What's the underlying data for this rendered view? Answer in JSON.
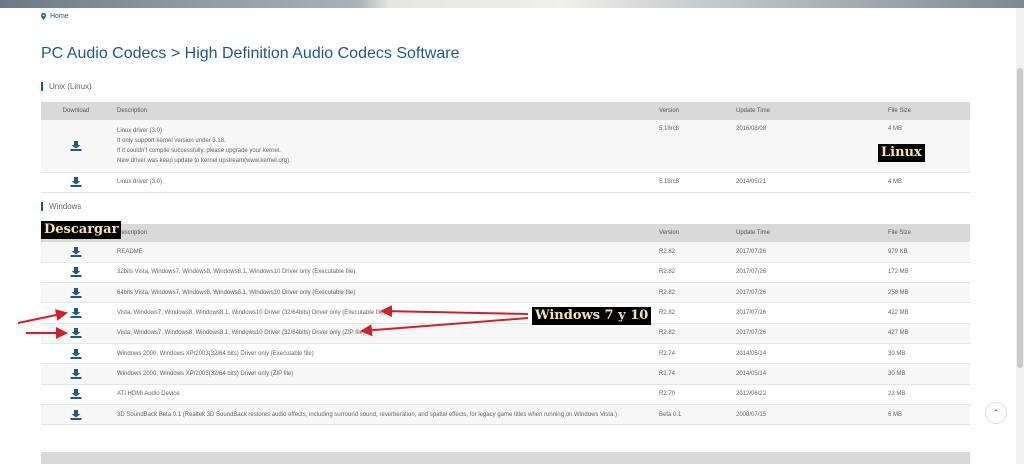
{
  "breadcrumb": {
    "home": "Home"
  },
  "page_title": "PC Audio Codecs > High Definition Audio Codecs Software",
  "columns": {
    "download": "Download",
    "description": "Description",
    "version": "Version",
    "update_time": "Update Time",
    "file_size": "File Size"
  },
  "unix": {
    "section_label": "Unix (Linux)",
    "rows": [
      {
        "lines": [
          "Linux driver (3.0)",
          "It only support kernel version under 3.18.",
          "If it couldn't compile successfully, please upgrade your kernel.",
          "New driver was keep update to kernel upstream(www.kernel.org)."
        ],
        "version": "5.18rc8",
        "date": "2016/08/08",
        "size": "4 MB"
      },
      {
        "lines": [
          "Linux driver (3.0)"
        ],
        "version": "5.18rc8",
        "date": "2014/05/21",
        "size": "4 MB"
      }
    ]
  },
  "windows": {
    "section_label": "Windows",
    "rows": [
      {
        "description": "README",
        "version": "R2.82",
        "date": "2017/07/26",
        "size": "979 KB"
      },
      {
        "description": "32bits Vista, Windows7, Windows8, Windows8.1, Windows10 Driver only (Executable file)",
        "version": "R2.82",
        "date": "2017/07/26",
        "size": "172 MB"
      },
      {
        "description": "64bits Vista, Windows7, Windows8, Windows8.1, Windows10 Driver only (Executable file)",
        "version": "R2.82",
        "date": "2017/07/26",
        "size": "258 MB"
      },
      {
        "description": "Vista, Windows7, Windows8, Windows8.1, Windows10 Driver (32/64bits) Driver only (Executable file)",
        "version": "R2.82",
        "date": "2017/07/26",
        "size": "422 MB"
      },
      {
        "description": "Vista, Windows7, Windows8, Windows8.1, Windows10 Driver (32/64bits) Driver only (ZIP file)",
        "version": "R2.82",
        "date": "2017/07/26",
        "size": "427 MB"
      },
      {
        "description": "Windows 2000, Windows XP/2003(32/64 bits) Driver only (Executable file)",
        "version": "R2.74",
        "date": "2014/05/14",
        "size": "30 MB"
      },
      {
        "description": "Windows 2000, Windows XP/2003(32/64 bits) Driver only (ZIP file)",
        "version": "R2.74",
        "date": "2014/05/14",
        "size": "30 MB"
      },
      {
        "description": "ATI HDMI Audio Device",
        "version": "R2.70",
        "date": "2012/06/22",
        "size": "22 MB"
      },
      {
        "description": "3D SoundBack Beta 0.1 (Realtek 3D SoundBack restores audio effects, including surround sound, reverberation, and spatial effects, for legacy game titles when running on Windows Vista.)",
        "version": "Beta 0.1",
        "date": "2008/07/15",
        "size": "6 MB"
      }
    ]
  },
  "annotations": {
    "linux": "Linux",
    "descargar": "Descargar",
    "win7_10": "Windows 7 y 10"
  },
  "colors": {
    "link_blue": "#1a5a8f",
    "annotation_arrow": "#d0202a",
    "annotation_text": "#f7e5a8"
  },
  "icons": {
    "download": "download-icon",
    "home": "map-pin-icon",
    "back_to_top": "chevron-up-icon"
  }
}
